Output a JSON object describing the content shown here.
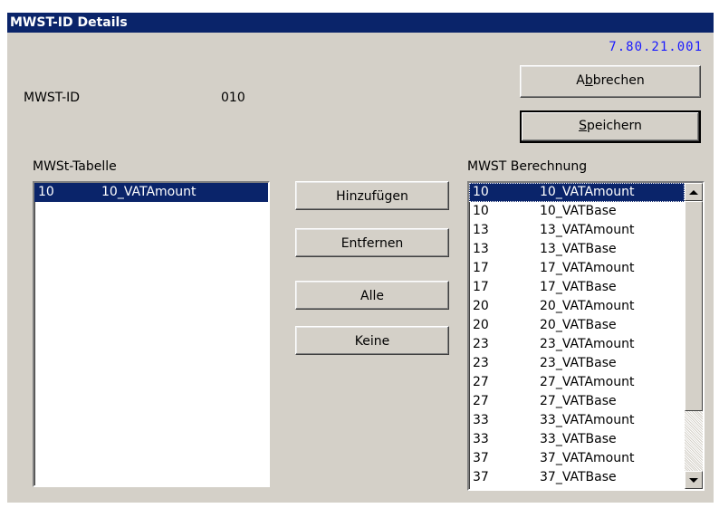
{
  "window": {
    "title": "MWST-ID Details",
    "version": "7.80.21.001"
  },
  "fields": {
    "mwst_id_label": "MWST-ID",
    "mwst_id_value": "010"
  },
  "buttons": {
    "abbrechen_pre": "A",
    "abbrechen_u": "b",
    "abbrechen_post": "brechen",
    "speichern_u": "S",
    "speichern_post": "peichern",
    "hinzufuegen": "Hinzufügen",
    "entfernen": "Entfernen",
    "alle": "Alle",
    "keine": "Keine"
  },
  "left_list": {
    "label": "MWSt-Tabelle",
    "items": [
      {
        "code": "10",
        "name": "10_VATAmount",
        "selected": true
      }
    ]
  },
  "right_list": {
    "label": "MWST Berechnung",
    "items": [
      {
        "code": "10",
        "name": "10_VATAmount",
        "selected": true
      },
      {
        "code": "10",
        "name": "10_VATBase"
      },
      {
        "code": "13",
        "name": "13_VATAmount"
      },
      {
        "code": "13",
        "name": "13_VATBase"
      },
      {
        "code": "17",
        "name": "17_VATAmount"
      },
      {
        "code": "17",
        "name": "17_VATBase"
      },
      {
        "code": "20",
        "name": "20_VATAmount"
      },
      {
        "code": "20",
        "name": "20_VATBase"
      },
      {
        "code": "23",
        "name": "23_VATAmount"
      },
      {
        "code": "23",
        "name": "23_VATBase"
      },
      {
        "code": "27",
        "name": "27_VATAmount"
      },
      {
        "code": "27",
        "name": "27_VATBase"
      },
      {
        "code": "33",
        "name": "33_VATAmount"
      },
      {
        "code": "33",
        "name": "33_VATBase"
      },
      {
        "code": "37",
        "name": "37_VATAmount"
      },
      {
        "code": "37",
        "name": "37_VATBase"
      }
    ]
  },
  "colors": {
    "titlebar": "#0a246a",
    "face": "#d4d0c8",
    "version_text": "#1a1aff",
    "selection": "#0a246a"
  }
}
